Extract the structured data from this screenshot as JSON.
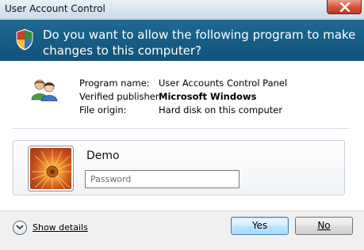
{
  "window": {
    "title": "User Account Control"
  },
  "header": {
    "question": "Do you want to allow the following program to make changes to this computer?"
  },
  "program": {
    "rows": [
      {
        "label": "Program name:",
        "value": "User Accounts Control Panel"
      },
      {
        "label": "Verified publisher:",
        "value": "Microsoft Windows"
      },
      {
        "label": "File origin:",
        "value": "Hard disk on this computer"
      }
    ]
  },
  "credentials": {
    "username": "Demo",
    "password_placeholder": "Password",
    "avatar_icon": "orange-flower-picture"
  },
  "footer": {
    "details_label": "Show details",
    "yes_label": "Yes",
    "no_label": "No"
  },
  "colors": {
    "header_bg": "#175c85",
    "accent_button_border": "#3c7fb1",
    "close_button": "#d6573f"
  }
}
